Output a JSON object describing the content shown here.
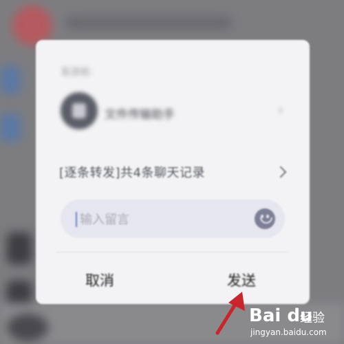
{
  "dialog": {
    "send_to_label": "发送给:",
    "target_name": "文件传输助手",
    "record_text": "[逐条转发]共4条聊天记录",
    "comment": {
      "placeholder": "输入留言",
      "value": ""
    },
    "cancel_label": "取消",
    "send_label": "发送"
  },
  "watermark": {
    "logo": "Bai du",
    "text": "经验",
    "url": "jingyan.baidu.com"
  },
  "colors": {
    "arrow": "#c8262b",
    "dialog_bg": "#f3f3f5",
    "input_bg": "#e5e6ef",
    "caret": "#6b7cc6"
  },
  "icons": [
    "chevron-right-icon",
    "emoji-icon",
    "arrow-annotation-icon"
  ]
}
